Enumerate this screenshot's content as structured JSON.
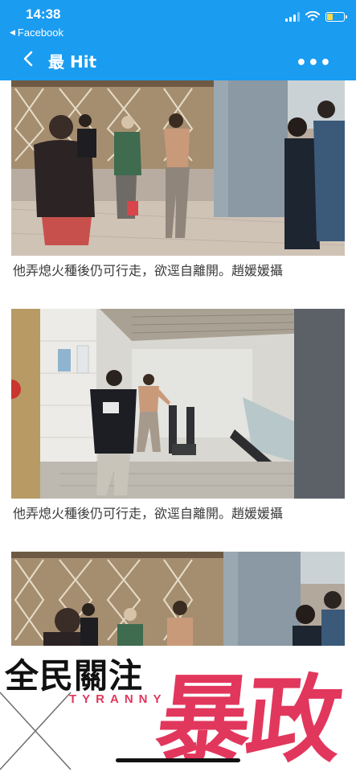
{
  "status_bar": {
    "time": "14:38",
    "back_app": "Facebook"
  },
  "nav": {
    "title": "最 Hit"
  },
  "captions": [
    "他弄熄火種後仍可行走，欲逕自離開。趙媛媛攝",
    "他弄熄火種後仍可行走，欲逕自離開。趙媛媛攝"
  ],
  "banner": {
    "brand_cn": "全民關注",
    "brand_en": "TYRANNY",
    "headline": "暴政",
    "accent_color": "#e2375d"
  },
  "colors": {
    "header_bg": "#1a9cf1",
    "caption_text": "#3b3b3b"
  }
}
